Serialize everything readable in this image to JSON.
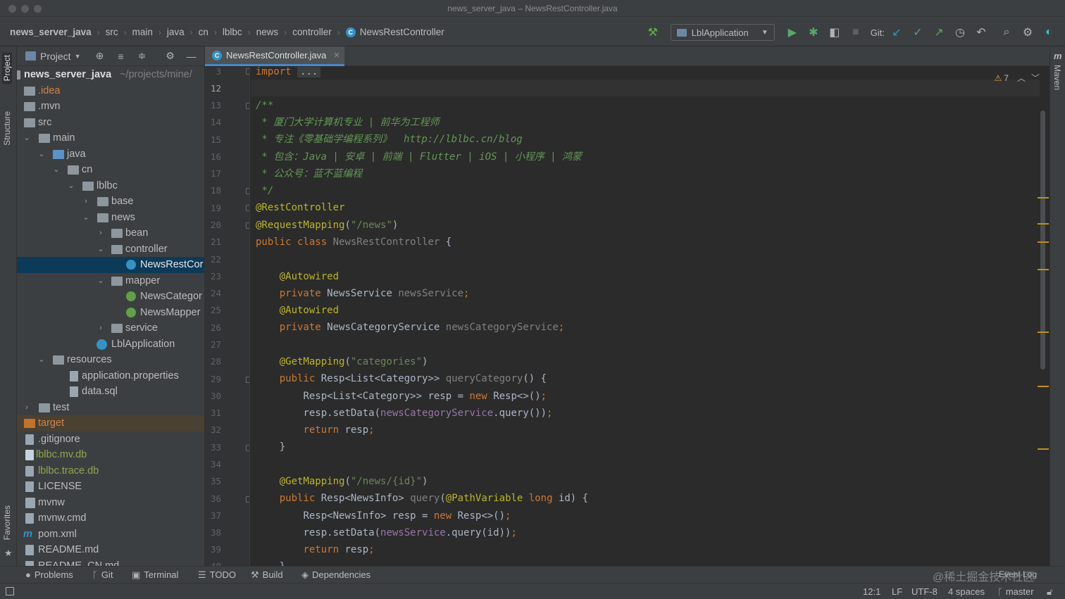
{
  "window": {
    "title": "news_server_java – NewsRestController.java"
  },
  "breadcrumbs": [
    "news_server_java",
    "src",
    "main",
    "java",
    "cn",
    "lblbc",
    "news",
    "controller",
    "NewsRestController"
  ],
  "toolbar": {
    "run_config": "LblApplication",
    "git_label": "Git:"
  },
  "left_tabs": {
    "project": "Project",
    "structure": "Structure",
    "favorites": "Favorites"
  },
  "right_tabs": {
    "maven": "Maven"
  },
  "project_panel": {
    "title": "Project",
    "root_name": "news_server_java",
    "root_path": "~/projects/mine/",
    "items": [
      {
        "label": ".idea"
      },
      {
        "label": ".mvn"
      },
      {
        "label": "src"
      },
      {
        "label": "main"
      },
      {
        "label": "java"
      },
      {
        "label": "cn"
      },
      {
        "label": "lblbc"
      },
      {
        "label": "base"
      },
      {
        "label": "news"
      },
      {
        "label": "bean"
      },
      {
        "label": "controller"
      },
      {
        "label": "NewsRestCor"
      },
      {
        "label": "mapper"
      },
      {
        "label": "NewsCategor"
      },
      {
        "label": "NewsMapper"
      },
      {
        "label": "service"
      },
      {
        "label": "LblApplication"
      },
      {
        "label": "resources"
      },
      {
        "label": "application.properties"
      },
      {
        "label": "data.sql"
      },
      {
        "label": "test"
      },
      {
        "label": "target"
      },
      {
        "label": ".gitignore"
      },
      {
        "label": "lblbc.mv.db"
      },
      {
        "label": "lblbc.trace.db"
      },
      {
        "label": "LICENSE"
      },
      {
        "label": "mvnw"
      },
      {
        "label": "mvnw.cmd"
      },
      {
        "label": "pom.xml"
      },
      {
        "label": "README.md"
      },
      {
        "label": "README_CN.md"
      }
    ]
  },
  "editor": {
    "tab_label": "NewsRestController.java",
    "inspection_count": "7",
    "line_numbers": [
      "3",
      "12",
      "13",
      "14",
      "15",
      "16",
      "17",
      "18",
      "19",
      "20",
      "21",
      "22",
      "23",
      "24",
      "25",
      "26",
      "27",
      "28",
      "29",
      "30",
      "31",
      "32",
      "33",
      "34",
      "35",
      "36",
      "37",
      "38",
      "39",
      "40"
    ],
    "code": {
      "l3_kw": "import",
      "l3_fold": "...",
      "l13": "/**",
      "l14": " * 厦门大学计算机专业 | 前华为工程师",
      "l15": " * 专注《零基础学编程系列》  http://lblbc.cn/blog",
      "l16": " * 包含：Java | 安卓 | 前端 | Flutter | iOS | 小程序 | 鸿蒙",
      "l17": " * 公众号：蓝不蓝编程",
      "l18": " */",
      "l19": "@RestController",
      "l20_ann": "@RequestMapping",
      "l20_str": "\"/news\"",
      "l21_kw": "public class",
      "l21_name": "NewsRestController",
      "l23": "@Autowired",
      "l24_kw": "private",
      "l24_type": "NewsService",
      "l24_field": "newsService",
      "l25": "@Autowired",
      "l26_kw": "private",
      "l26_type": "NewsCategoryService",
      "l26_field": "newsCategoryService",
      "l28_ann": "@GetMapping",
      "l28_str": "\"categories\"",
      "l29_kw": "public",
      "l29_type": "Resp<List<Category>>",
      "l29_method": "queryCategory",
      "l30_type": "Resp<List<Category>> resp = ",
      "l30_kw": "new",
      "l30_rest": "Resp<>()",
      "l31_a": "resp.setData(",
      "l31_field": "newsCategoryService",
      "l31_b": ".query())",
      "l32_kw": "return",
      "l32_rest": "resp",
      "l33": "}",
      "l35_ann": "@GetMapping",
      "l35_str": "\"/news/{id}\"",
      "l36_kw": "public",
      "l36_type": "Resp<NewsInfo>",
      "l36_method": "query",
      "l36_ann": "@PathVariable",
      "l36_kw2": "long",
      "l36_rest": "id) {",
      "l37_type": "Resp<NewsInfo> resp = ",
      "l37_kw": "new",
      "l37_rest": "Resp<>()",
      "l38_a": "resp.setData(",
      "l38_field": "newsService",
      "l38_b": ".query(id))",
      "l39_kw": "return",
      "l39_rest": "resp"
    }
  },
  "bottom_tabs": [
    "Problems",
    "Git",
    "Terminal",
    "TODO",
    "Build",
    "Dependencies"
  ],
  "event_log": "Event Log",
  "status": {
    "position": "12:1",
    "line_sep": "LF",
    "encoding": "UTF-8",
    "indent": "4 spaces",
    "branch": "master"
  },
  "watermark": "@稀土掘金技术社区",
  "colors": {
    "accent": "#4a88c7",
    "keyword": "#cc7832",
    "annotation": "#bbb529",
    "string": "#6a8759",
    "doc": "#629755",
    "field": "#9876aa",
    "selection": "#0d3a58"
  }
}
